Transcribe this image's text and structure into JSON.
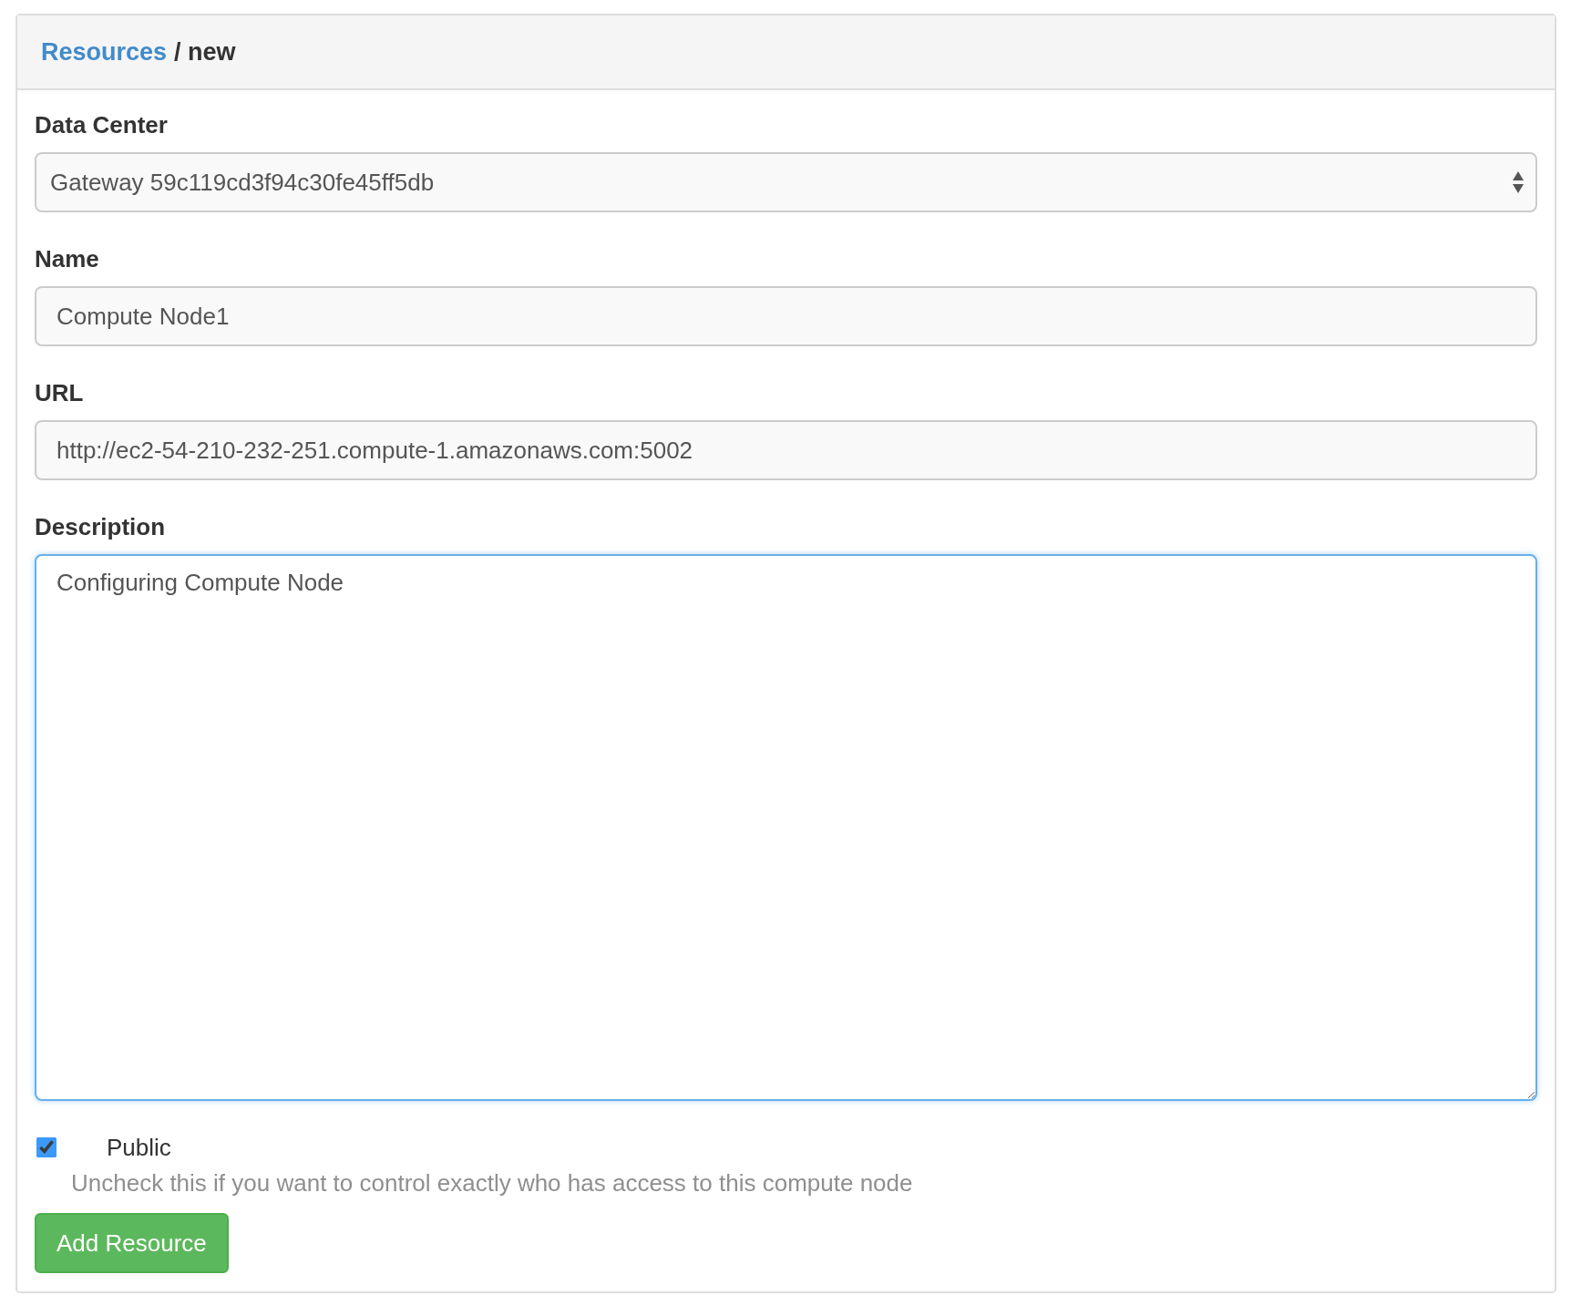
{
  "breadcrumb": {
    "link": "Resources",
    "separator": "/",
    "current": "new"
  },
  "fields": [
    {
      "kind": "select",
      "label": "Data Center",
      "value": "Gateway 59c119cd3f94c30fe45ff5db",
      "focused": false
    },
    {
      "kind": "text",
      "label": "Name",
      "value": "Compute Node1",
      "focused": false
    },
    {
      "kind": "text",
      "label": "URL",
      "value": "http://ec2-54-210-232-251.compute-1.amazonaws.com:5002",
      "focused": false
    },
    {
      "kind": "textarea",
      "label": "Description",
      "value": "Configuring Compute Node",
      "focused": true
    }
  ],
  "public_option": {
    "label": "Public",
    "checked": true,
    "help": "Uncheck this if you want to control exactly who has access to this compute node"
  },
  "submit_button": {
    "label": "Add Resource"
  }
}
